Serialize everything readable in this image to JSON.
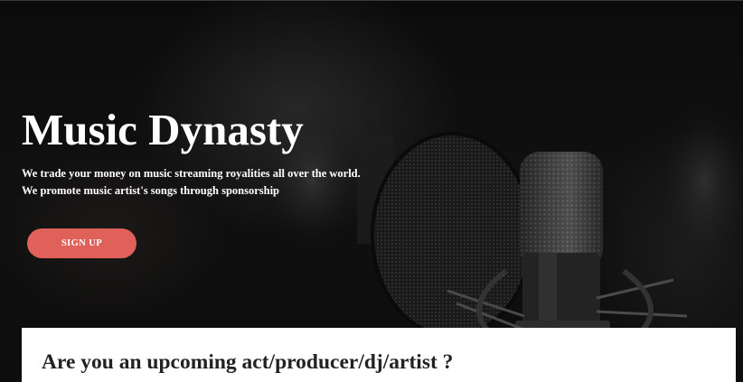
{
  "hero": {
    "title": "Music Dynasty",
    "tagline_line1": "We trade your money on music streaming royalities all over the world.",
    "tagline_line2": "We promote music artist's songs through sponsorship",
    "signup_label": "SIGN UP"
  },
  "section": {
    "heading": "Are you an upcoming act/producer/dj/artist ?"
  },
  "colors": {
    "button_bg": "#e0605a",
    "hero_text": "#ffffff",
    "card_bg": "#ffffff",
    "heading_text": "#222222"
  }
}
